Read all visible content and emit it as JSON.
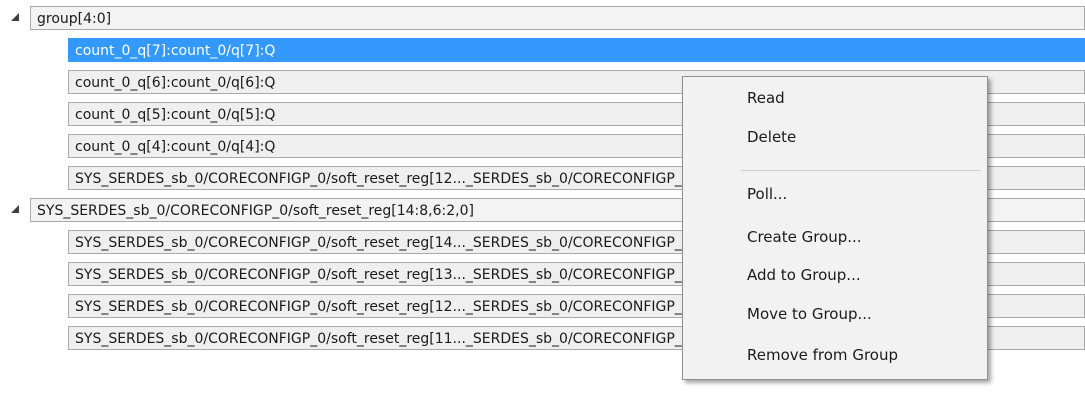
{
  "tree": {
    "groups": [
      {
        "label": "group[4:0]",
        "children": [
          "count_0_q[7]:count_0/q[7]:Q",
          "count_0_q[6]:count_0/q[6]:Q",
          "count_0_q[5]:count_0/q[5]:Q",
          "count_0_q[4]:count_0/q[4]:Q",
          "SYS_SERDES_sb_0/CORECONFIGP_0/soft_reset_reg[12..._SERDES_sb_0/CORECONFIGP_0/soft_reset_reg[12]:Q"
        ]
      },
      {
        "label": "SYS_SERDES_sb_0/CORECONFIGP_0/soft_reset_reg[14:8,6:2,0]",
        "children": [
          "SYS_SERDES_sb_0/CORECONFIGP_0/soft_reset_reg[14..._SERDES_sb_0/CORECONFIGP_0/soft_reset_reg[14]:Q",
          "SYS_SERDES_sb_0/CORECONFIGP_0/soft_reset_reg[13..._SERDES_sb_0/CORECONFIGP_0/soft_reset_reg[13]:Q",
          "SYS_SERDES_sb_0/CORECONFIGP_0/soft_reset_reg[12..._SERDES_sb_0/CORECONFIGP_0/soft_reset_reg[12]:Q",
          "SYS_SERDES_sb_0/CORECONFIGP_0/soft_reset_reg[11..._SERDES_sb_0/CORECONFIGP_0/soft_reset_reg[11]:Q"
        ]
      }
    ]
  },
  "context_menu": {
    "read": "Read",
    "delete": "Delete",
    "poll": "Poll...",
    "create_group": "Create Group...",
    "add_to_group": "Add to Group...",
    "move_to_group": "Move to Group...",
    "remove_from_group": "Remove from Group"
  },
  "colors": {
    "selection": "#3399ff",
    "row_border": "#a9a9a9"
  }
}
